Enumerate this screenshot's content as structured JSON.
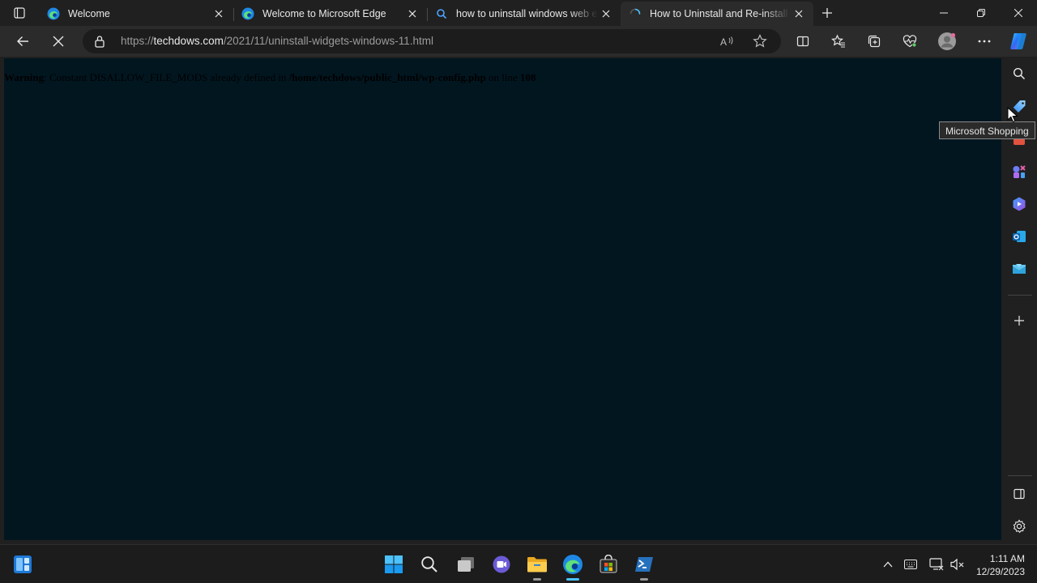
{
  "tabs": [
    {
      "title": "Welcome",
      "favicon": "edge-icon",
      "active": false
    },
    {
      "title": "Welcome to Microsoft Edge",
      "favicon": "edge-icon",
      "active": false
    },
    {
      "title": "how to uninstall windows web ex",
      "favicon": "search-icon",
      "active": false
    },
    {
      "title": "How to Uninstall and Re-install W",
      "favicon": "loading-spinner-icon",
      "active": true
    }
  ],
  "address": {
    "url_scheme": "https://",
    "url_domain": "techdows.com",
    "url_path": "/2021/11/uninstall-widgets-windows-11.html"
  },
  "page": {
    "warning_label": "Warning",
    "warning_text": ": Constant DISALLOW_FILE_MODS already defined in",
    "warning_path": "/home/techdows/public_html/wp-config.php",
    "warning_on_line": "on line",
    "warning_line": "108"
  },
  "sidebar": {
    "tooltip": "Microsoft Shopping",
    "items": [
      "search-icon",
      "shopping-tag-icon",
      "tools-icon",
      "games-icon",
      "office-icon",
      "outlook-icon",
      "drop-icon",
      "add-icon"
    ]
  },
  "taskbar": {
    "time": "1:11 AM",
    "date": "12/29/2023"
  },
  "colors": {
    "content_bg": "#021620",
    "accent": "#4cc2ff"
  }
}
